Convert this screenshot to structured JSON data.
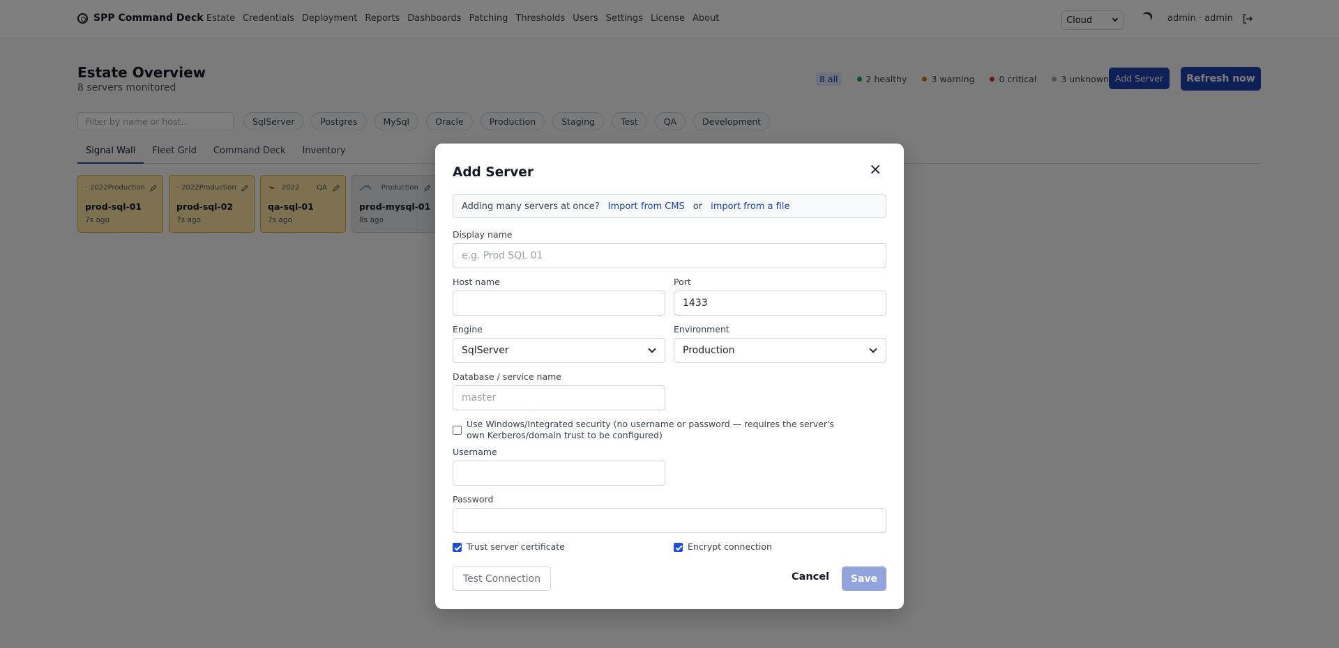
{
  "app": {
    "title": "SPP Command Deck"
  },
  "nav": [
    "Estate",
    "Credentials",
    "Deployment",
    "Reports",
    "Dashboards",
    "Patching",
    "Thresholds",
    "Users",
    "Settings",
    "License",
    "About"
  ],
  "header": {
    "environment": "Cloud",
    "user": "admin · admin"
  },
  "page": {
    "title": "Estate Overview",
    "subtitle": "8 servers monitored"
  },
  "status": {
    "all": "8 all",
    "healthy": "2 healthy",
    "warning": "3 warning",
    "critical": "0 critical",
    "unknown": "3 unknown",
    "colors": {
      "healthy": "#16a34a",
      "warning": "#d97706",
      "critical": "#dc2626",
      "unknown": "#9ca3af"
    }
  },
  "actions": {
    "add_server": "Add Server",
    "refresh": "Refresh now"
  },
  "filter": {
    "placeholder": "Filter by name or host..."
  },
  "chips": [
    "SqlServer",
    "Postgres",
    "MySql",
    "Oracle",
    "Production",
    "Staging",
    "Test",
    "QA",
    "Development"
  ],
  "tabs": [
    "Signal Wall",
    "Fleet Grid",
    "Command Deck",
    "Inventory"
  ],
  "cards": [
    {
      "version": "2022",
      "env": "Production",
      "name": "prod-sql-01",
      "age": "7s  ago",
      "icon": "dot-icon"
    },
    {
      "version": "2022",
      "env": "Production",
      "name": "prod-sql-02",
      "age": "7s  ago",
      "icon": "dot-icon"
    },
    {
      "version": "2022",
      "env": "QA",
      "name": "qa-sql-01",
      "age": "7s  ago",
      "icon": "sqlserver-icon"
    },
    {
      "version": "",
      "env": "Production",
      "name": "prod-mysql-01",
      "age": "8s  ago",
      "icon": "mysql-icon"
    }
  ],
  "modal": {
    "title": "Add Server",
    "import_prompt": "Adding many servers at once?",
    "import_cms": "Import from CMS",
    "or": "or",
    "import_file": "import from a file",
    "display_name": {
      "label": "Display name",
      "placeholder": "e.g. Prod SQL 01",
      "value": ""
    },
    "host_name": {
      "label": "Host name",
      "value": ""
    },
    "port": {
      "label": "Port",
      "value": "1433"
    },
    "engine": {
      "label": "Engine",
      "value": "SqlServer"
    },
    "environment": {
      "label": "Environment",
      "value": "Production"
    },
    "database": {
      "label": "Database / service name",
      "placeholder": "master"
    },
    "integrated_security": {
      "label": "Use Windows/Integrated security (no username or password — requires the server's own Kerberos/domain trust to be configured)",
      "checked": false
    },
    "username": {
      "label": "Username",
      "value": ""
    },
    "password": {
      "label": "Password",
      "value": ""
    },
    "trust_cert": {
      "label": "Trust server certificate",
      "checked": true
    },
    "encrypt": {
      "label": "Encrypt connection",
      "checked": true
    },
    "test_button": "Test Connection",
    "cancel_button": "Cancel",
    "save_button": "Save"
  }
}
